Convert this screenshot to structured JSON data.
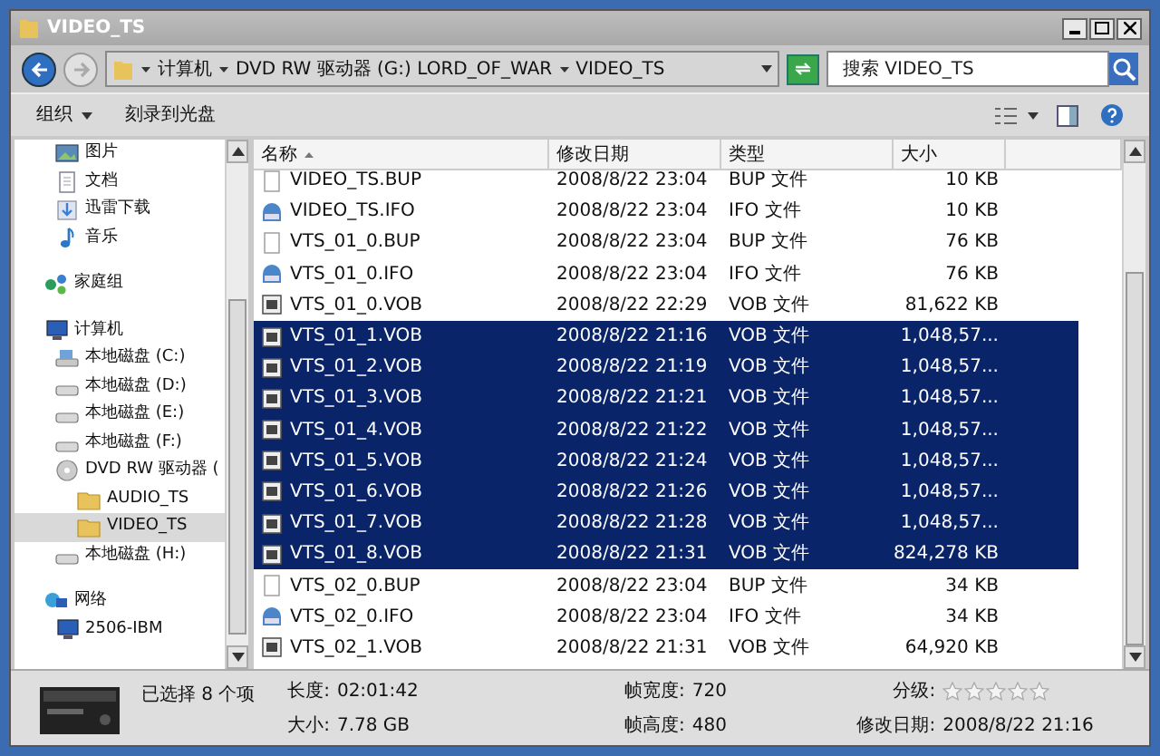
{
  "window": {
    "title": "VIDEO_TS"
  },
  "address": {
    "path": [
      {
        "label": "计算机"
      },
      {
        "label": "DVD RW 驱动器 (G:) LORD_OF_WAR"
      },
      {
        "label": "VIDEO_TS"
      }
    ]
  },
  "search": {
    "placeholder": "搜索 VIDEO_TS"
  },
  "toolbar": {
    "items": [
      {
        "label": "组织",
        "dropdown": true
      },
      {
        "label": "刻录到光盘",
        "dropdown": false
      }
    ]
  },
  "sidebar": {
    "groups": [
      {
        "items": [
          {
            "label": "图片",
            "kind": "picture"
          },
          {
            "label": "文档",
            "kind": "document"
          },
          {
            "label": "迅雷下载",
            "kind": "download"
          },
          {
            "label": "音乐",
            "kind": "music"
          }
        ]
      },
      {
        "items": [
          {
            "label": "家庭组",
            "kind": "homegroup",
            "selected": false
          }
        ]
      },
      {
        "items": [
          {
            "label": "计算机",
            "kind": "computer",
            "selected": false,
            "children": [
              {
                "label": "本地磁盘 (C:)",
                "kind": "system-drive",
                "selected": false
              },
              {
                "label": "本地磁盘 (D:)",
                "kind": "drive",
                "selected": false
              },
              {
                "label": "本地磁盘 (E:)",
                "kind": "drive",
                "selected": false
              },
              {
                "label": "本地磁盘 (F:)",
                "kind": "drive",
                "selected": false
              },
              {
                "label": "DVD RW 驱动器 (",
                "kind": "dvd",
                "selected": false,
                "children": [
                  {
                    "label": "AUDIO_TS",
                    "kind": "folder",
                    "selected": false
                  },
                  {
                    "label": "VIDEO_TS",
                    "kind": "folder",
                    "selected": true
                  }
                ]
              },
              {
                "label": "本地磁盘 (H:)",
                "kind": "drive",
                "selected": false
              }
            ]
          }
        ]
      },
      {
        "items": [
          {
            "label": "网络",
            "kind": "network",
            "selected": false,
            "children": [
              {
                "label": "2506-IBM",
                "kind": "computer",
                "selected": false
              }
            ]
          }
        ]
      }
    ]
  },
  "table": {
    "columns": [
      {
        "label": "名称",
        "sorted": true
      },
      {
        "label": "修改日期",
        "sorted": false
      },
      {
        "label": "类型",
        "sorted": false
      },
      {
        "label": "大小",
        "sorted": false
      }
    ],
    "rows": [
      {
        "name": "VIDEO_TS.BUP",
        "date": "2008/8/22 23:04",
        "type": "BUP 文件",
        "size": "10 KB",
        "kind": "blank",
        "selected": false
      },
      {
        "name": "VIDEO_TS.IFO",
        "date": "2008/8/22 23:04",
        "type": "IFO 文件",
        "size": "10 KB",
        "kind": "info",
        "selected": false
      },
      {
        "name": "VTS_01_0.BUP",
        "date": "2008/8/22 23:04",
        "type": "BUP 文件",
        "size": "76 KB",
        "kind": "blank",
        "selected": false
      },
      {
        "name": "VTS_01_0.IFO",
        "date": "2008/8/22 23:04",
        "type": "IFO 文件",
        "size": "76 KB",
        "kind": "info",
        "selected": false
      },
      {
        "name": "VTS_01_0.VOB",
        "date": "2008/8/22 22:29",
        "type": "VOB 文件",
        "size": "81,622 KB",
        "kind": "video",
        "selected": false
      },
      {
        "name": "VTS_01_1.VOB",
        "date": "2008/8/22 21:16",
        "type": "VOB 文件",
        "size": "1,048,57...",
        "kind": "video",
        "selected": true
      },
      {
        "name": "VTS_01_2.VOB",
        "date": "2008/8/22 21:19",
        "type": "VOB 文件",
        "size": "1,048,57...",
        "kind": "video",
        "selected": true
      },
      {
        "name": "VTS_01_3.VOB",
        "date": "2008/8/22 21:21",
        "type": "VOB 文件",
        "size": "1,048,57...",
        "kind": "video",
        "selected": true
      },
      {
        "name": "VTS_01_4.VOB",
        "date": "2008/8/22 21:22",
        "type": "VOB 文件",
        "size": "1,048,57...",
        "kind": "video",
        "selected": true
      },
      {
        "name": "VTS_01_5.VOB",
        "date": "2008/8/22 21:24",
        "type": "VOB 文件",
        "size": "1,048,57...",
        "kind": "video",
        "selected": true
      },
      {
        "name": "VTS_01_6.VOB",
        "date": "2008/8/22 21:26",
        "type": "VOB 文件",
        "size": "1,048,57...",
        "kind": "video",
        "selected": true
      },
      {
        "name": "VTS_01_7.VOB",
        "date": "2008/8/22 21:28",
        "type": "VOB 文件",
        "size": "1,048,57...",
        "kind": "video",
        "selected": true
      },
      {
        "name": "VTS_01_8.VOB",
        "date": "2008/8/22 21:31",
        "type": "VOB 文件",
        "size": "824,278 KB",
        "kind": "video",
        "selected": true
      },
      {
        "name": "VTS_02_0.BUP",
        "date": "2008/8/22 23:04",
        "type": "BUP 文件",
        "size": "34 KB",
        "kind": "blank",
        "selected": false
      },
      {
        "name": "VTS_02_0.IFO",
        "date": "2008/8/22 23:04",
        "type": "IFO 文件",
        "size": "34 KB",
        "kind": "info",
        "selected": false
      },
      {
        "name": "VTS_02_1.VOB",
        "date": "2008/8/22 21:31",
        "type": "VOB 文件",
        "size": "64,920 KB",
        "kind": "video",
        "selected": false
      }
    ]
  },
  "details": {
    "selection": "已选择 8 个项",
    "fields": [
      {
        "label": "长度:",
        "value": "02:01:42"
      },
      {
        "label": "大小:",
        "value": "7.78 GB"
      },
      {
        "label": "帧宽度:",
        "value": "720"
      },
      {
        "label": "帧高度:",
        "value": "480"
      }
    ],
    "rating": {
      "label": "分级:",
      "stars": 0
    },
    "modified": {
      "label": "修改日期:",
      "value": "2008/8/22 21:16"
    }
  }
}
